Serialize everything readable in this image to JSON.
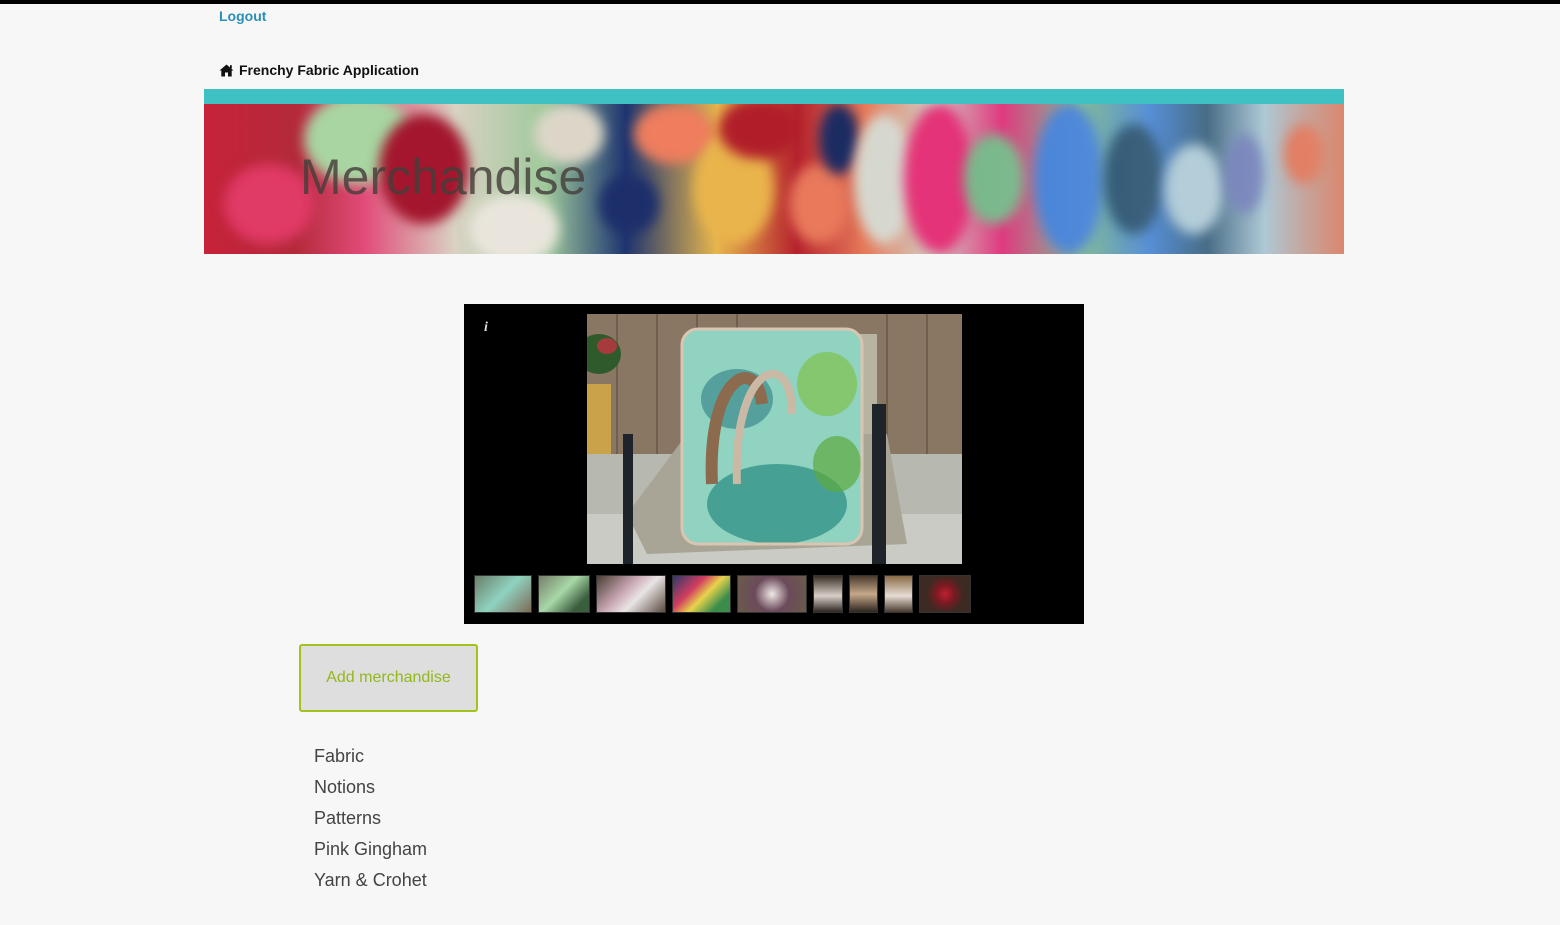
{
  "header": {
    "logout_label": "Logout",
    "brand_label": "Frenchy Fabric Application",
    "brand_icon": "home-icon"
  },
  "banner": {
    "title": "Merchandise"
  },
  "gallery": {
    "info_label": "i",
    "thumbnail_count": 9
  },
  "actions": {
    "add_label": "Add merchandise"
  },
  "categories": [
    {
      "label": "Fabric"
    },
    {
      "label": "Notions"
    },
    {
      "label": "Patterns"
    },
    {
      "label": "Pink Gingham"
    },
    {
      "label": "Yarn & Crohet"
    }
  ],
  "colors": {
    "accent_teal": "#3fc1c4",
    "link_blue": "#2a8fb8",
    "button_green": "#a2c21d",
    "page_bg": "#f7f7f7"
  }
}
